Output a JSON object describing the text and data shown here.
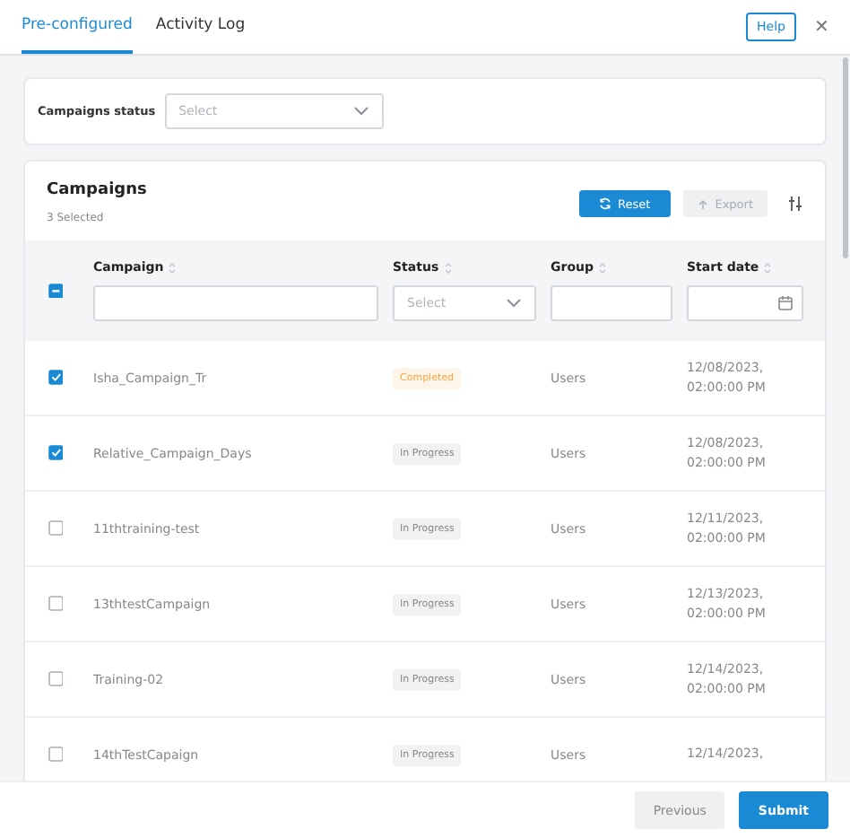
{
  "tabs": [
    {
      "label": "Pre-configured",
      "selected": true
    },
    {
      "label": "Activity Log",
      "selected": false
    }
  ],
  "help_button": "Help",
  "close_icon": "✕",
  "filter": {
    "label": "Campaigns status",
    "placeholder": "Select"
  },
  "campaigns": {
    "title": "Campaigns",
    "selected_count": "3 Selected",
    "reset_button": "Reset",
    "export_button": {
      "label": "Export",
      "disabled": true
    },
    "select_all_partial": true,
    "columns": [
      {
        "label": "Campaign",
        "kind": "text"
      },
      {
        "label": "Status",
        "kind": "select",
        "placeholder": "Select"
      },
      {
        "label": "Group",
        "kind": "text"
      },
      {
        "label": "Start date",
        "kind": "date"
      }
    ],
    "rows": [
      {
        "checked": true,
        "campaign": "Isha_Campaign_Tr",
        "status": {
          "label": "Completed",
          "color": "#f5a742"
        },
        "group": "Users",
        "date": "12/08/2023,",
        "time": "02:00:00 PM"
      },
      {
        "checked": true,
        "campaign": "Relative_Campaign_Days",
        "status": {
          "label": "In Progress",
          "color": "#888888"
        },
        "group": "Users",
        "date": "12/08/2023,",
        "time": "02:00:00 PM"
      },
      {
        "checked": false,
        "campaign": "11thtraining-test",
        "status": {
          "label": "In Progress",
          "color": "#888888"
        },
        "group": "Users",
        "date": "12/11/2023,",
        "time": "02:00:00 PM"
      },
      {
        "checked": false,
        "campaign": "13thtestCampaign",
        "status": {
          "label": "In Progress",
          "color": "#888888"
        },
        "group": "Users",
        "date": "12/13/2023,",
        "time": "02:00:00 PM"
      },
      {
        "checked": false,
        "campaign": "Training-02",
        "status": {
          "label": "In Progress",
          "color": "#888888"
        },
        "group": "Users",
        "date": "12/14/2023,",
        "time": "02:00:00 PM"
      },
      {
        "checked": false,
        "campaign": "14thTestCapaign",
        "status": {
          "label": "In Progress",
          "color": "#888888"
        },
        "group": "Users",
        "date": "12/14/2023,"
      }
    ]
  },
  "footer": {
    "previous_button": "Previous",
    "submit_button": "Submit"
  }
}
